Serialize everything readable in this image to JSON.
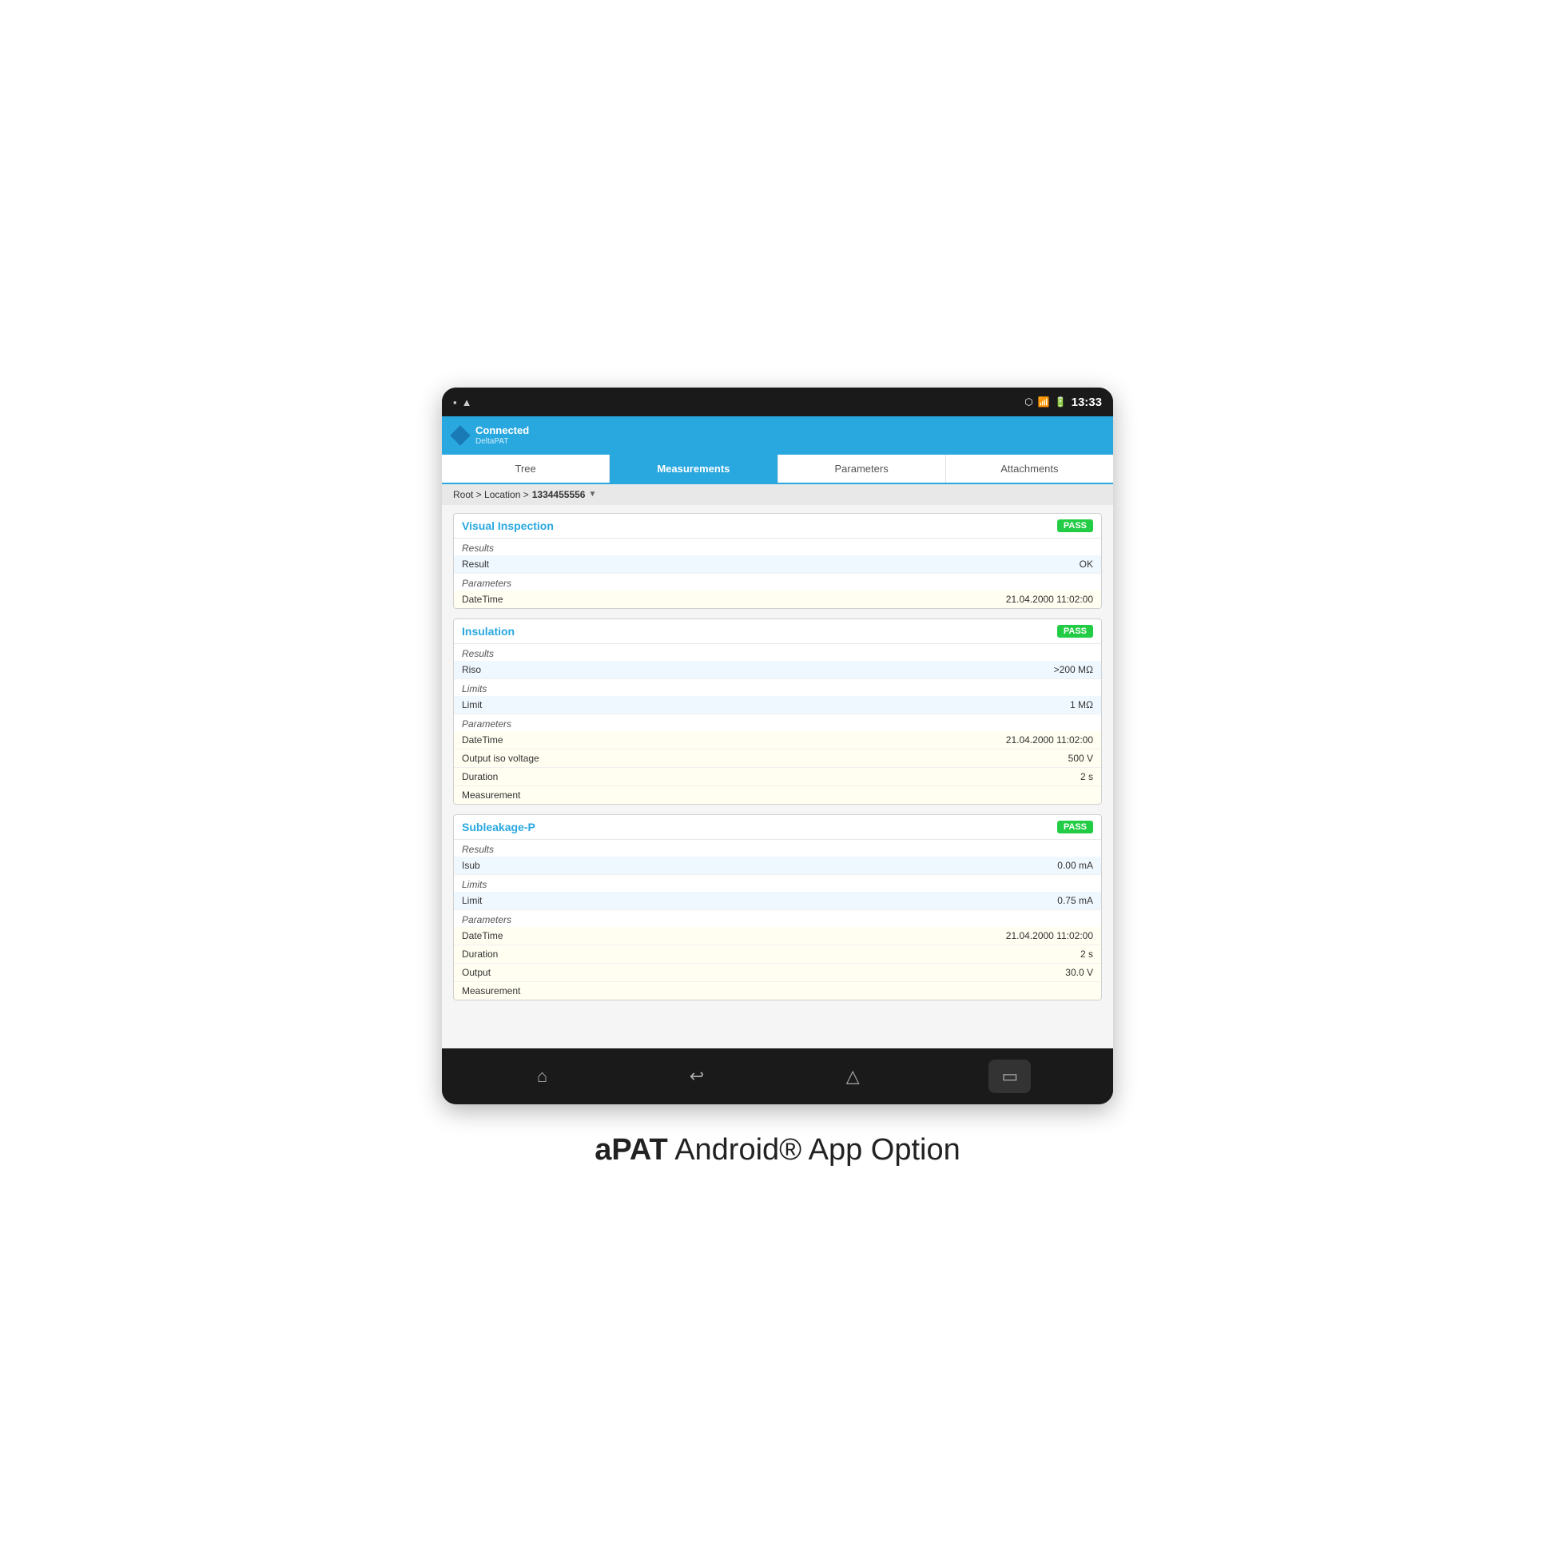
{
  "status_bar": {
    "time": "13:33",
    "icons_left": [
      "■",
      "▲"
    ],
    "icons_right": [
      "BT",
      "WiFi",
      "🔋"
    ]
  },
  "brand": {
    "name": "Connected",
    "sub": "DeltaPAT"
  },
  "tabs": [
    {
      "label": "Tree",
      "active": false
    },
    {
      "label": "Measurements",
      "active": true
    },
    {
      "label": "Parameters",
      "active": false
    },
    {
      "label": "Attachments",
      "active": false
    }
  ],
  "breadcrumb": {
    "path": "Root > Location > ",
    "id": "1334455556",
    "filter_icon": "▼"
  },
  "sections": [
    {
      "title": "Visual Inspection",
      "badge": "PASS",
      "results_label": "Results",
      "results": [
        {
          "label": "Result",
          "value": "OK",
          "type": "result"
        }
      ],
      "params_label": "Parameters",
      "params": [
        {
          "label": "DateTime",
          "value": "21.04.2000 11:02:00",
          "type": "param"
        }
      ]
    },
    {
      "title": "Insulation",
      "badge": "PASS",
      "results_label": "Results",
      "results": [
        {
          "label": "Riso",
          "value": ">200 MΩ",
          "type": "result"
        }
      ],
      "limits_label": "Limits",
      "limits": [
        {
          "label": "Limit",
          "value": "1 MΩ",
          "type": "result"
        }
      ],
      "params_label": "Parameters",
      "params": [
        {
          "label": "DateTime",
          "value": "21.04.2000 11:02:00",
          "type": "param"
        },
        {
          "label": "Output iso voltage",
          "value": "500 V",
          "type": "param"
        },
        {
          "label": "Duration",
          "value": "2 s",
          "type": "param"
        },
        {
          "label": "Measurement",
          "value": "",
          "type": "param"
        }
      ]
    },
    {
      "title": "Subleakage-P",
      "badge": "PASS",
      "results_label": "Results",
      "results": [
        {
          "label": "Isub",
          "value": "0.00 mA",
          "type": "result"
        }
      ],
      "limits_label": "Limits",
      "limits": [
        {
          "label": "Limit",
          "value": "0.75 mA",
          "type": "result"
        }
      ],
      "params_label": "Parameters",
      "params": [
        {
          "label": "DateTime",
          "value": "21.04.2000 11:02:00",
          "type": "param"
        },
        {
          "label": "Duration",
          "value": "2 s",
          "type": "param"
        },
        {
          "label": "Output",
          "value": "30.0 V",
          "type": "param"
        },
        {
          "label": "Measurement",
          "value": "",
          "type": "param"
        }
      ]
    }
  ],
  "nav_buttons": [
    "⌂",
    "↩",
    "△",
    "▭"
  ],
  "footer": {
    "bold": "aPAT",
    "regular": " Android® App Option"
  }
}
